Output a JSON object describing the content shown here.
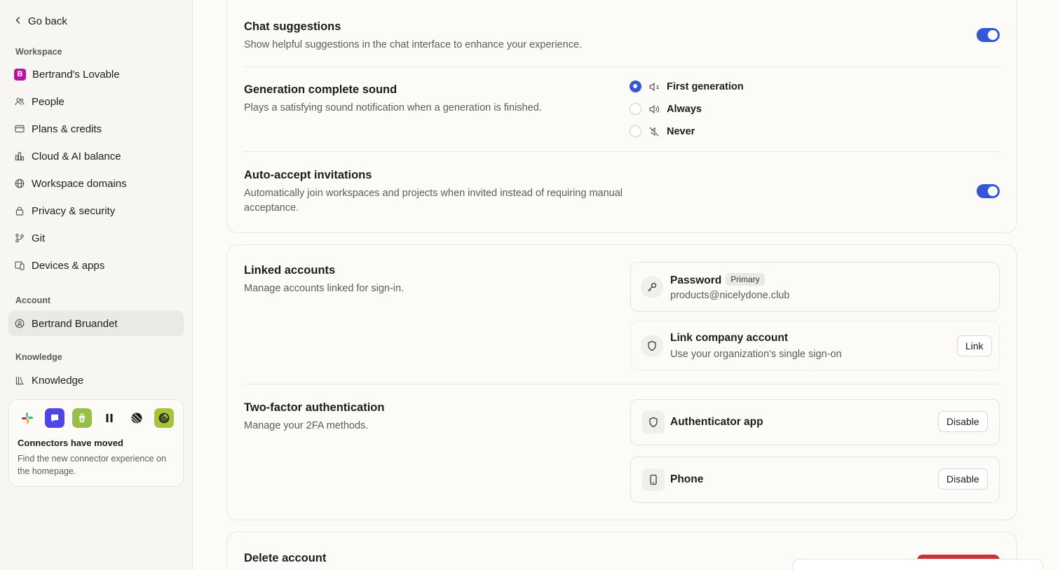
{
  "sidebar": {
    "go_back": "Go back",
    "workspace_label": "Workspace",
    "workspace_items": [
      {
        "label": "Bertrand's Lovable",
        "badge": "B"
      },
      {
        "label": "People"
      },
      {
        "label": "Plans & credits"
      },
      {
        "label": "Cloud & AI balance"
      },
      {
        "label": "Workspace domains"
      },
      {
        "label": "Privacy & security"
      },
      {
        "label": "Git"
      },
      {
        "label": "Devices & apps"
      }
    ],
    "account_label": "Account",
    "account_items": [
      {
        "label": "Bertrand Bruandet",
        "active": true
      }
    ],
    "knowledge_label": "Knowledge",
    "knowledge_items": [
      {
        "label": "Knowledge"
      }
    ],
    "connector_card": {
      "icons": [
        "slack-icon",
        "chat-app-icon",
        "shopify-icon",
        "pause-app-icon",
        "linear-icon",
        "spiral-app-icon"
      ],
      "title": "Connectors have moved",
      "description": "Find the new connector experience on the homepage."
    }
  },
  "preferences": {
    "chat_suggestions": {
      "title": "Chat suggestions",
      "description": "Show helpful suggestions in the chat interface to enhance your experience.",
      "enabled": true
    },
    "generation_sound": {
      "title": "Generation complete sound",
      "description": "Plays a satisfying sound notification when a generation is finished.",
      "options": [
        {
          "label": "First generation",
          "icon": "volume-low-icon",
          "selected": true
        },
        {
          "label": "Always",
          "icon": "volume-high-icon",
          "selected": false
        },
        {
          "label": "Never",
          "icon": "volume-off-icon",
          "selected": false
        }
      ]
    },
    "auto_accept": {
      "title": "Auto-accept invitations",
      "description": "Automatically join workspaces and projects when invited instead of requiring manual acceptance.",
      "enabled": true
    }
  },
  "security": {
    "linked_accounts": {
      "title": "Linked accounts",
      "description": "Manage accounts linked for sign-in.",
      "password": {
        "title": "Password",
        "badge": "Primary",
        "email": "products@nicelydone.club"
      },
      "company": {
        "title": "Link company account",
        "subtitle": "Use your organization's single sign-on",
        "button": "Link"
      }
    },
    "two_factor": {
      "title": "Two-factor authentication",
      "description": "Manage your 2FA methods.",
      "methods": [
        {
          "label": "Authenticator app",
          "button": "Disable",
          "icon": "shield-icon"
        },
        {
          "label": "Phone",
          "button": "Disable",
          "icon": "phone-icon"
        }
      ]
    }
  },
  "danger": {
    "delete_account": {
      "title": "Delete account"
    }
  },
  "colors": {
    "accent": "#3656d8",
    "danger": "#c93535",
    "workspace_badge": "#b5179e"
  }
}
